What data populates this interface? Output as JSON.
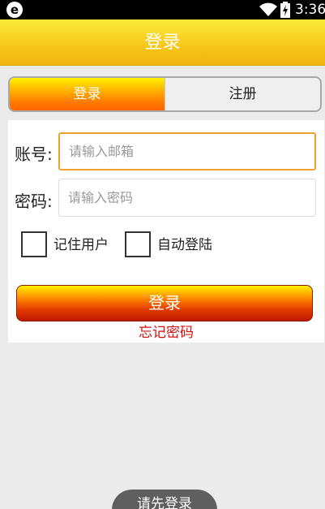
{
  "status_bar": {
    "browser_glyph": "e",
    "time": "3:36",
    "icons": [
      "wifi-icon",
      "battery-icon"
    ]
  },
  "header": {
    "title": "登录"
  },
  "tabs": [
    {
      "label": "登录",
      "active": true
    },
    {
      "label": "注册",
      "active": false
    }
  ],
  "form": {
    "account_label": "账号:",
    "account_placeholder": "请输入邮箱",
    "account_value": "",
    "password_label": "密码:",
    "password_placeholder": "请输入密码",
    "password_value": "",
    "remember_user_label": "记住用户",
    "remember_user_checked": false,
    "auto_login_label": "自动登陆",
    "auto_login_checked": false,
    "login_button_label": "登录",
    "forgot_password_label": "忘记密码"
  },
  "toast": {
    "text": "请先登录"
  },
  "colors": {
    "header_yellow": "#f6c61a",
    "tab_active_orange": "#ff7a00",
    "input_focus_border": "#f0a030",
    "button_red": "#e03800",
    "forgot_link_red": "#d21010",
    "background": "#ebebeb"
  }
}
